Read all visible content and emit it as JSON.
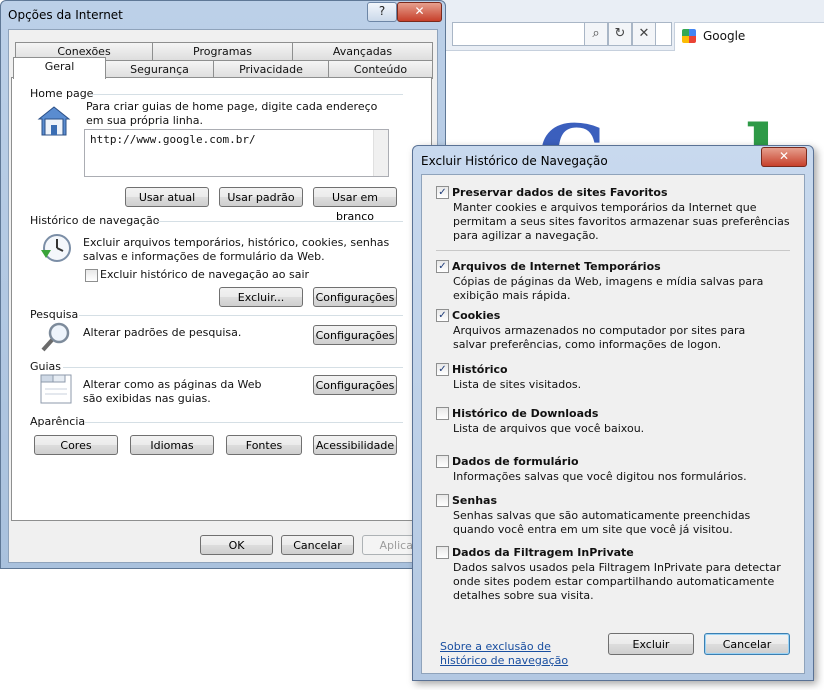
{
  "browser": {
    "google_tab_label": "Google"
  },
  "internet_options": {
    "title": "Opções da Internet",
    "help_label": "?",
    "close_label": "✕",
    "tabs_row1": [
      "Conexões",
      "Programas",
      "Avançadas"
    ],
    "tabs_row2": [
      "Geral",
      "Segurança",
      "Privacidade",
      "Conteúdo"
    ],
    "home_page": {
      "label": "Home page",
      "description": "Para criar guias de home page, digite cada endereço em sua própria linha.",
      "url_value": "http://www.google.com.br/",
      "use_current": "Usar atual",
      "use_default": "Usar padrão",
      "use_blank": "Usar em branco"
    },
    "history": {
      "label": "Histórico de navegação",
      "description": "Excluir arquivos temporários, histórico, cookies, senhas salvas e informações de formulário da Web.",
      "checkbox_label": "Excluir histórico de navegação ao sair",
      "checkbox_checked": false,
      "delete_button": "Excluir...",
      "settings_button": "Configurações"
    },
    "search": {
      "label": "Pesquisa",
      "description": "Alterar padrões de pesquisa.",
      "settings_button": "Configurações"
    },
    "tabs_group": {
      "label": "Guias",
      "description": "Alterar como as páginas da Web são exibidas nas guias.",
      "settings_button": "Configurações"
    },
    "appearance": {
      "label": "Aparência",
      "colors": "Cores",
      "languages": "Idiomas",
      "fonts": "Fontes",
      "accessibility": "Acessibilidade"
    },
    "ok": "OK",
    "cancel": "Cancelar",
    "apply": "Aplicar"
  },
  "delete_history": {
    "title": "Excluir Histórico de Navegação",
    "close_label": "✕",
    "items": [
      {
        "title": "Preservar dados de sites Favoritos",
        "desc": "Manter cookies e arquivos temporários da Internet que permitam a seus sites favoritos armazenar suas preferências para agilizar a navegação.",
        "checked": true
      },
      {
        "title": "Arquivos de Internet Temporários",
        "desc": "Cópias de páginas da Web, imagens e mídia salvas para exibição mais rápida.",
        "checked": true
      },
      {
        "title": "Cookies",
        "desc": "Arquivos armazenados no computador por sites para salvar preferências, como informações de logon.",
        "checked": true
      },
      {
        "title": "Histórico",
        "desc": "Lista de sites visitados.",
        "checked": true
      },
      {
        "title": "Histórico de Downloads",
        "desc": "Lista de arquivos que você baixou.",
        "checked": false
      },
      {
        "title": "Dados de formulário",
        "desc": "Informações salvas que você digitou nos formulários.",
        "checked": false
      },
      {
        "title": "Senhas",
        "desc": "Senhas salvas que são automaticamente preenchidas quando você entra em um site que você já visitou.",
        "checked": false
      },
      {
        "title": "Dados da Filtragem InPrivate",
        "desc": "Dados salvos usados pela Filtragem InPrivate para detectar onde sites podem estar compartilhando automaticamente detalhes sobre sua visita.",
        "checked": false
      }
    ],
    "link_text": "Sobre a exclusão de histórico de navegação",
    "delete_button": "Excluir",
    "cancel_button": "Cancelar"
  }
}
